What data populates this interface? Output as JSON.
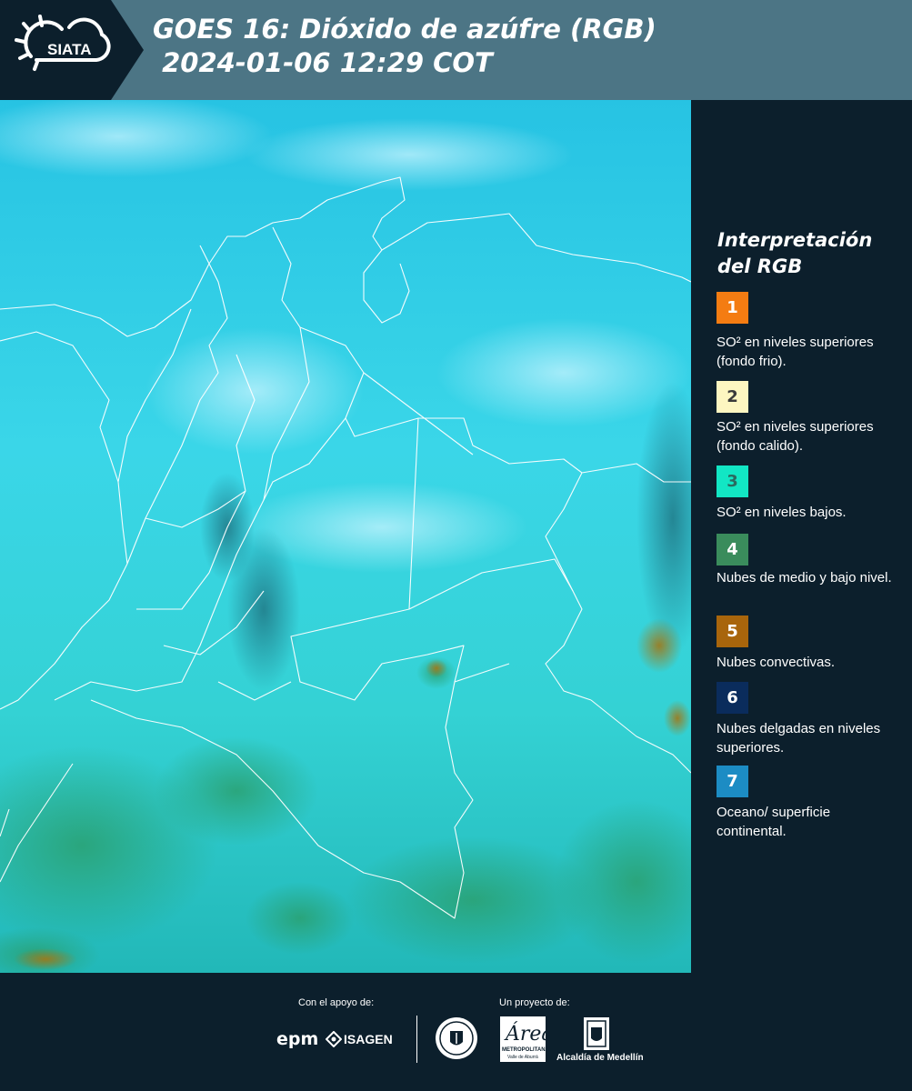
{
  "header": {
    "title_line1": "GOES 16: Dióxido de azúfre (RGB)",
    "title_line2": " 2024-01-06 12:29 COT",
    "logo_text": "SIATA",
    "logo_icon": "sun-cloud-icon"
  },
  "legend": {
    "title": "Interpretación del RGB",
    "items": [
      {
        "num": "1",
        "label": "SO² en niveles superiores (fondo frio).",
        "color": "#f47c12",
        "text_color": "#ffffff"
      },
      {
        "num": "2",
        "label": "SO² en niveles superiores (fondo calido).",
        "color": "#fdf6c1",
        "text_color": "#3a3a3a"
      },
      {
        "num": "3",
        "label": "SO² en niveles bajos.",
        "color": "#12e6c4",
        "text_color": "#2a6a60"
      },
      {
        "num": "4",
        "label": "Nubes de medio y bajo nivel.",
        "color": "#3a8c5c",
        "text_color": "#ffffff"
      },
      {
        "num": "5",
        "label": "Nubes convectivas.",
        "color": "#a8650c",
        "text_color": "#ffffff"
      },
      {
        "num": "6",
        "label": "Nubes delgadas en niveles superiores.",
        "color": "#0a2c5c",
        "text_color": "#ffffff"
      },
      {
        "num": "7",
        "label": "Oceano/ superficie continental.",
        "color": "#1c8cc4",
        "text_color": "#ffffff"
      }
    ]
  },
  "footer": {
    "support_caption": "Con el apoyo de:",
    "project_caption": "Un proyecto de:",
    "sponsors": [
      "epm",
      "ISAGEN"
    ],
    "partners": [
      "Área Metropolitana Valle de Aburrá",
      "Alcaldía de Medellín"
    ],
    "metro_text": "METROPOLITANA",
    "metro_sub": "Valle de Aburrá",
    "alcaldia_text": "Alcaldía de Medellín"
  },
  "colors": {
    "header_bg": "#4c7585",
    "panel_bg": "#0c1f2c",
    "map_base": "#35d4e6"
  }
}
